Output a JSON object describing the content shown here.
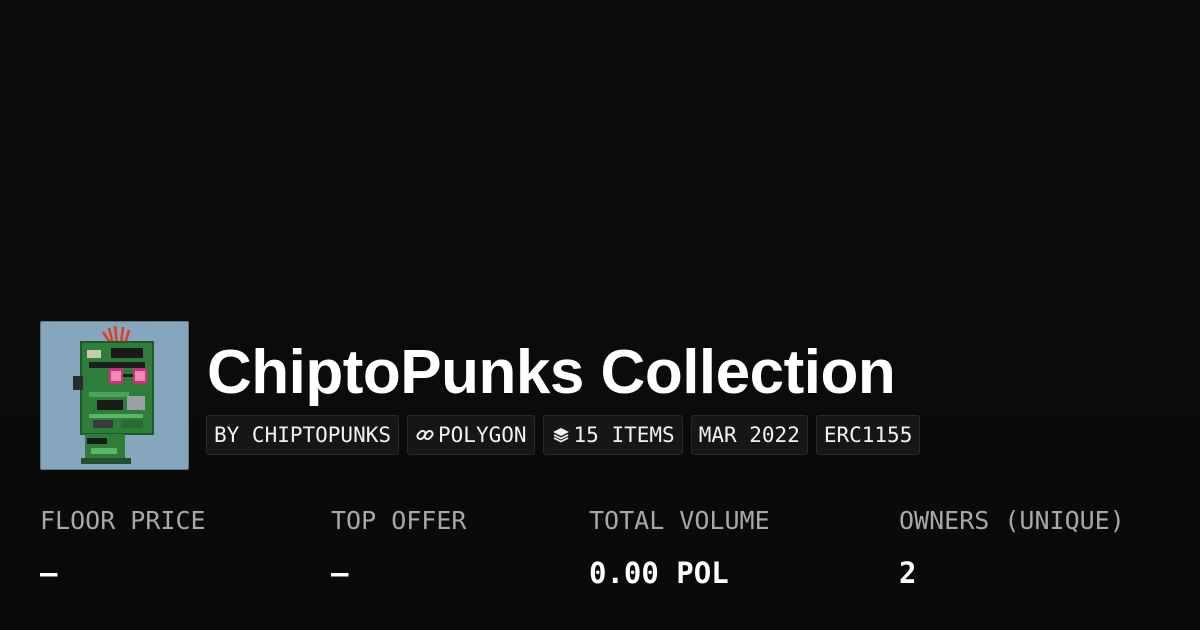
{
  "collection": {
    "title": "ChiptoPunks Collection",
    "avatar_alt": "ChiptoPunks avatar"
  },
  "tags": [
    {
      "label": "BY CHIPTOPUNKS",
      "icon": null
    },
    {
      "label": "POLYGON",
      "icon": "link-icon"
    },
    {
      "label": "15 ITEMS",
      "icon": "layers-icon"
    },
    {
      "label": "MAR 2022",
      "icon": null
    },
    {
      "label": "ERC1155",
      "icon": null
    }
  ],
  "stats": [
    {
      "label": "FLOOR PRICE",
      "value": "–"
    },
    {
      "label": "TOP OFFER",
      "value": "–"
    },
    {
      "label": "TOTAL VOLUME",
      "value": "0.00 POL"
    },
    {
      "label": "OWNERS (UNIQUE)",
      "value": "2"
    }
  ],
  "colors": {
    "background": "#0b0b0b",
    "tag_background": "#161616",
    "label_gray": "#a8a8a8",
    "avatar_background": "#86a6bd"
  }
}
